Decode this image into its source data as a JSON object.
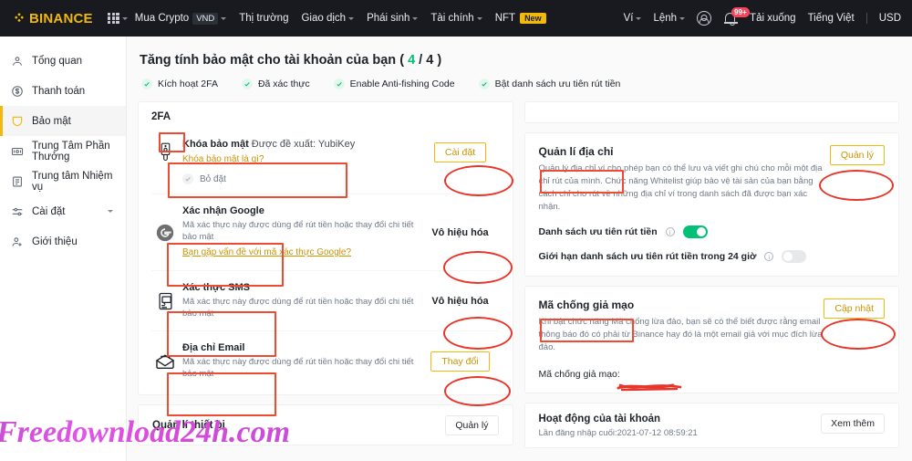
{
  "topnav": {
    "brand": "BINANCE",
    "items": [
      {
        "label": "Mua Crypto",
        "chip": "VND",
        "caret": true
      },
      {
        "label": "Thị trường",
        "caret": false
      },
      {
        "label": "Giao dịch",
        "caret": true
      },
      {
        "label": "Phái sinh",
        "caret": true
      },
      {
        "label": "Tài chính",
        "caret": true
      },
      {
        "label": "NFT",
        "new_chip": "New",
        "caret": false
      }
    ],
    "right": {
      "wallet": "Ví",
      "orders": "Lệnh",
      "notification_badge": "99+",
      "download": "Tải xuống",
      "language": "Tiếng Việt",
      "currency": "USD"
    }
  },
  "sidebar": {
    "items": [
      {
        "label": "Tổng quan",
        "icon": "user-icon",
        "active": false
      },
      {
        "label": "Thanh toán",
        "icon": "dollar-circle-icon",
        "active": false
      },
      {
        "label": "Bảo mật",
        "icon": "shield-icon",
        "active": true
      },
      {
        "label": "Trung Tâm Phần Thưởng",
        "icon": "ticket-icon",
        "active": false
      },
      {
        "label": "Trung tâm Nhiệm vụ",
        "icon": "clipboard-icon",
        "active": false
      },
      {
        "label": "Cài đặt",
        "icon": "sliders-icon",
        "active": false,
        "caret": true
      },
      {
        "label": "Giới thiệu",
        "icon": "user-plus-icon",
        "active": false
      }
    ]
  },
  "header": {
    "title_prefix": "Tăng tính bảo mật cho tài khoản của bạn ( ",
    "score": "4",
    "title_suffix": " / 4 )",
    "checks": [
      "Kích hoạt 2FA",
      "Đã xác thực",
      "Enable Anti-fishing Code",
      "Bật danh sách ưu tiên rút tiền"
    ]
  },
  "twofa": {
    "title": "2FA",
    "rows": [
      {
        "icon": "usb-key-icon",
        "name": "Khóa bảo mật",
        "name_suffix": "Được đề xuất: YubiKey",
        "link": "Khóa bảo mật là gì?",
        "desc": "",
        "action": "Cài đặt",
        "action_style": "outline",
        "unset_label": "Bỏ đặt"
      },
      {
        "icon": "google-icon",
        "name": "Xác nhận Google",
        "name_suffix": "",
        "desc": "Mã xác thực này được dùng để rút tiền hoặc thay đổi chi tiết bảo mật",
        "link": "Bạn gặp vấn đề với mã xác thực Google?",
        "action": "Vô hiệu hóa",
        "action_style": "plain"
      },
      {
        "icon": "sms-icon",
        "name": "Xác thực SMS",
        "name_suffix": "",
        "desc": "Mã xác thực này được dùng để rút tiền hoặc thay đổi chi tiết bảo mật",
        "link": "",
        "action": "Vô hiệu hóa",
        "action_style": "plain"
      },
      {
        "icon": "email-icon",
        "name": "Địa chỉ Email",
        "name_suffix": "",
        "desc": "Mã xác thực này được dùng để rút tiền hoặc thay đổi chi tiết bảo mật",
        "link": "",
        "action": "Thay đổi",
        "action_style": "outline"
      }
    ]
  },
  "device_card": {
    "title": "Quản lí thiết bị",
    "action": "Quản lý"
  },
  "address_card": {
    "title": "Quản lí địa chỉ",
    "desc": "Quản lý địa chỉ ví cho phép bạn có thể lưu và viết ghi chú cho mỗi một địa chỉ rút của mình. Chức năng Whitelist giúp bảo vệ tài sản của bạn bằng cách chỉ cho rút về những địa chỉ ví trong danh sách đã được bạn xác nhận.",
    "action": "Quản lý",
    "toggles": [
      {
        "label": "Danh sách ưu tiên rút tiền",
        "on": true
      },
      {
        "label": "Giới hạn danh sách ưu tiên rút tiền trong 24 giờ",
        "on": false
      }
    ]
  },
  "antiphishing_card": {
    "title": "Mã chống giả mạo",
    "desc": "Khi bật chức năng Mã chống lừa đảo, bạn sẽ có thể biết được rằng email thông báo đó có phải từ Binance hay đó là một email giả với mục đích lừa đảo.",
    "action": "Cập nhật",
    "code_label": "Mã chống giả mạo:"
  },
  "activity_card": {
    "title": "Hoạt động của tài khoản",
    "subtitle": "Lần đăng nhập cuối:2021-07-12 08:59:21",
    "action": "Xem thêm"
  },
  "watermark": "Freedownload24h.com",
  "colors": {
    "brand_yellow": "#f0b90b",
    "nav_dark": "#181a20",
    "green": "#02c076",
    "annotation_red": "#e8352a",
    "annotation_orange": "#f04a32",
    "watermark_pink": "#d64bd6"
  }
}
